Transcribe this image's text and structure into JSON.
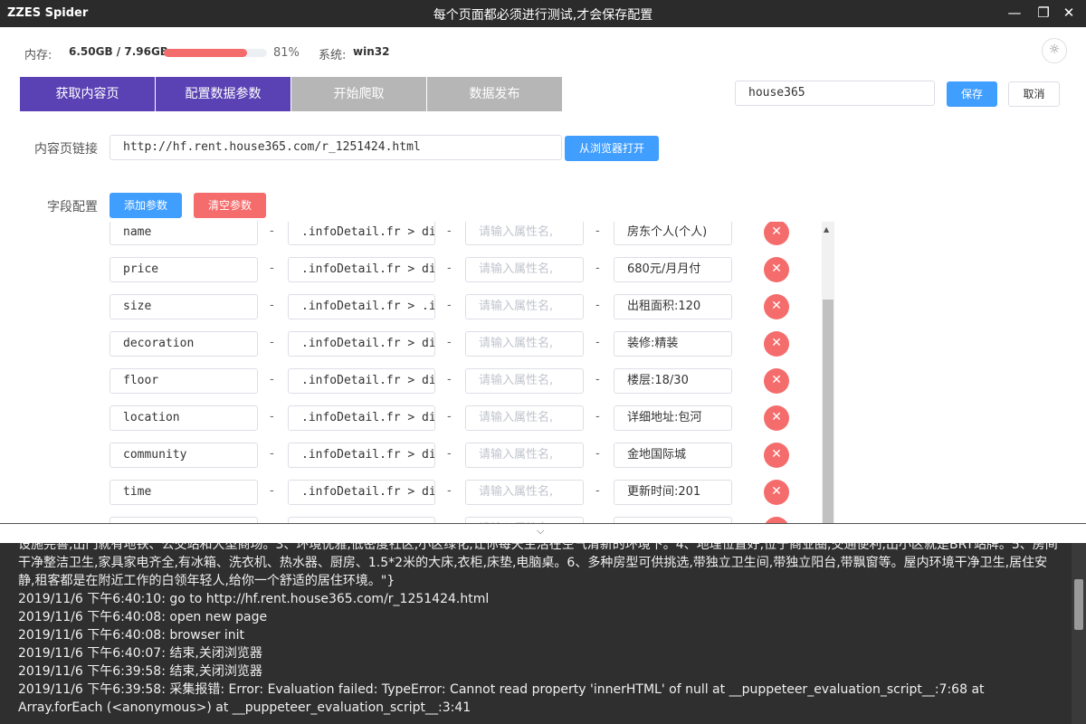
{
  "titlebar": {
    "app_name": "ZZES Spider",
    "window_title": "每个页面都必须进行测试,才会保存配置",
    "minimize": "—",
    "restore": "❐",
    "close": "✕"
  },
  "status": {
    "memory_label": "内存:",
    "memory_value": "6.50GB / 7.96GB",
    "memory_percent": 81,
    "memory_percent_text": "81%",
    "system_label": "系统:",
    "system_value": "win32",
    "settings_icon": "gear-icon",
    "settings_glyph": "☼"
  },
  "steps": [
    {
      "label": "获取内容页",
      "active": true
    },
    {
      "label": "配置数据参数",
      "active": true
    },
    {
      "label": "开始爬取",
      "active": false
    },
    {
      "label": "数据发布",
      "active": false
    }
  ],
  "header": {
    "name_value": "house365",
    "save_label": "保存",
    "cancel_label": "取消"
  },
  "content_url": {
    "label": "内容页链接",
    "value": "http://hf.rent.house365.com/r_1251424.html",
    "open_label": "从浏览器打开"
  },
  "fields": {
    "label": "字段配置",
    "add_label": "添加参数",
    "clear_label": "清空参数",
    "attr_placeholder": "请输入属性名,",
    "separator": "-",
    "delete_glyph": "✕",
    "rows": [
      {
        "name": "name",
        "selector": ".infoDetail.fr > div",
        "preview": "房东个人(个人)"
      },
      {
        "name": "price",
        "selector": ".infoDetail.fr > div",
        "preview": "680元/月月付"
      },
      {
        "name": "size",
        "selector": ".infoDetail.fr > .in",
        "preview": "出租面积:120"
      },
      {
        "name": "decoration",
        "selector": ".infoDetail.fr > div",
        "preview": "装修:精装"
      },
      {
        "name": "floor",
        "selector": ".infoDetail.fr > div",
        "preview": "楼层:18/30"
      },
      {
        "name": "location",
        "selector": ".infoDetail.fr > div",
        "preview": "详细地址:包河"
      },
      {
        "name": "community",
        "selector": ".infoDetail.fr > div",
        "preview": "金地国际城"
      },
      {
        "name": "time",
        "selector": ".infoDetail.fr > div",
        "preview": "更新时间:201"
      },
      {
        "name": "",
        "selector": "",
        "preview": ""
      }
    ]
  },
  "panel": {
    "chevron_glyph": "⌵"
  },
  "log": {
    "lines": [
      "设施完善,出门就有地铁、公交站和大型商场。3、环境优雅,低密度社区,小区绿化,让你每天生活在空气清新的环境下。4、地理位置好,位于商业圈,交通便利,出小区就是BRT站牌。5、房间干净整洁卫生,家具家电齐全,有冰箱、洗衣机、热水器、厨房、1.5*2米的大床,衣柜,床垫,电脑桌。6、多种房型可供挑选,带独立卫生间,带独立阳台,带飘窗等。屋内环境干净卫生,居住安静,租客都是在附近工作的白领年轻人,给你一个舒适的居住环境。\"}",
      "2019/11/6 下午6:40:10: go to http://hf.rent.house365.com/r_1251424.html",
      "2019/11/6 下午6:40:08: open new page",
      "2019/11/6 下午6:40:08: browser init",
      "2019/11/6 下午6:40:07: 结束,关闭浏览器",
      "2019/11/6 下午6:39:58: 结束,关闭浏览器",
      "2019/11/6 下午6:39:58: 采集报错: Error: Evaluation failed: TypeError: Cannot read property 'innerHTML' of null at __puppeteer_evaluation_script__:7:68 at Array.forEach (<anonymous>) at __puppeteer_evaluation_script__:3:41"
    ]
  }
}
